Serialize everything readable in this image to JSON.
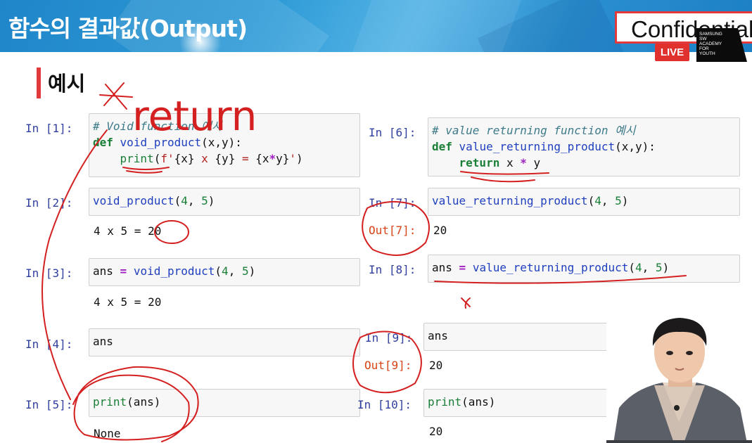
{
  "header": {
    "title": "함수의 결과값(Output)",
    "confidential": "Confidential",
    "live_badge": "LIVE",
    "logo_lines": [
      "SAMSUNG",
      "SW",
      "ACADEMY",
      "FOR",
      "YOUTH"
    ]
  },
  "section": {
    "title": "예시"
  },
  "annotations": {
    "handwritten_return": "return"
  },
  "left_cells": [
    {
      "prompt": "In [1]:",
      "lines": [
        "# Void function 예시",
        "def void_product(x,y):",
        "    print(f'{x} x {y} = {x*y}')"
      ]
    },
    {
      "prompt": "In [2]:",
      "code": "void_product(4, 5)",
      "output": "4 x 5 = 20"
    },
    {
      "prompt": "In [3]:",
      "code": "ans = void_product(4, 5)",
      "output": "4 x 5 = 20"
    },
    {
      "prompt": "In [4]:",
      "code": "ans"
    },
    {
      "prompt": "In [5]:",
      "code": "print(ans)",
      "output": "None"
    }
  ],
  "right_cells": [
    {
      "prompt": "In [6]:",
      "lines": [
        "# value returning function 예시",
        "def value_returning_product(x,y):",
        "    return x * y"
      ]
    },
    {
      "prompt": "In [7]:",
      "code": "value_returning_product(4, 5)",
      "out_prompt": "Out[7]:",
      "output": "20"
    },
    {
      "prompt": "In [8]:",
      "code": "ans = value_returning_product(4, 5)"
    },
    {
      "prompt": "In [9]:",
      "code": "ans",
      "out_prompt": "Out[9]:",
      "output": "20"
    },
    {
      "prompt": "In [10]:",
      "code": "print(ans)",
      "output": "20"
    }
  ],
  "colors": {
    "banner": "#2d9ad6",
    "accent_red": "#e23a3a",
    "in_prompt": "#303f9f",
    "out_prompt": "#d84315",
    "keyword": "#1a7f37",
    "ink": "#d42020"
  }
}
